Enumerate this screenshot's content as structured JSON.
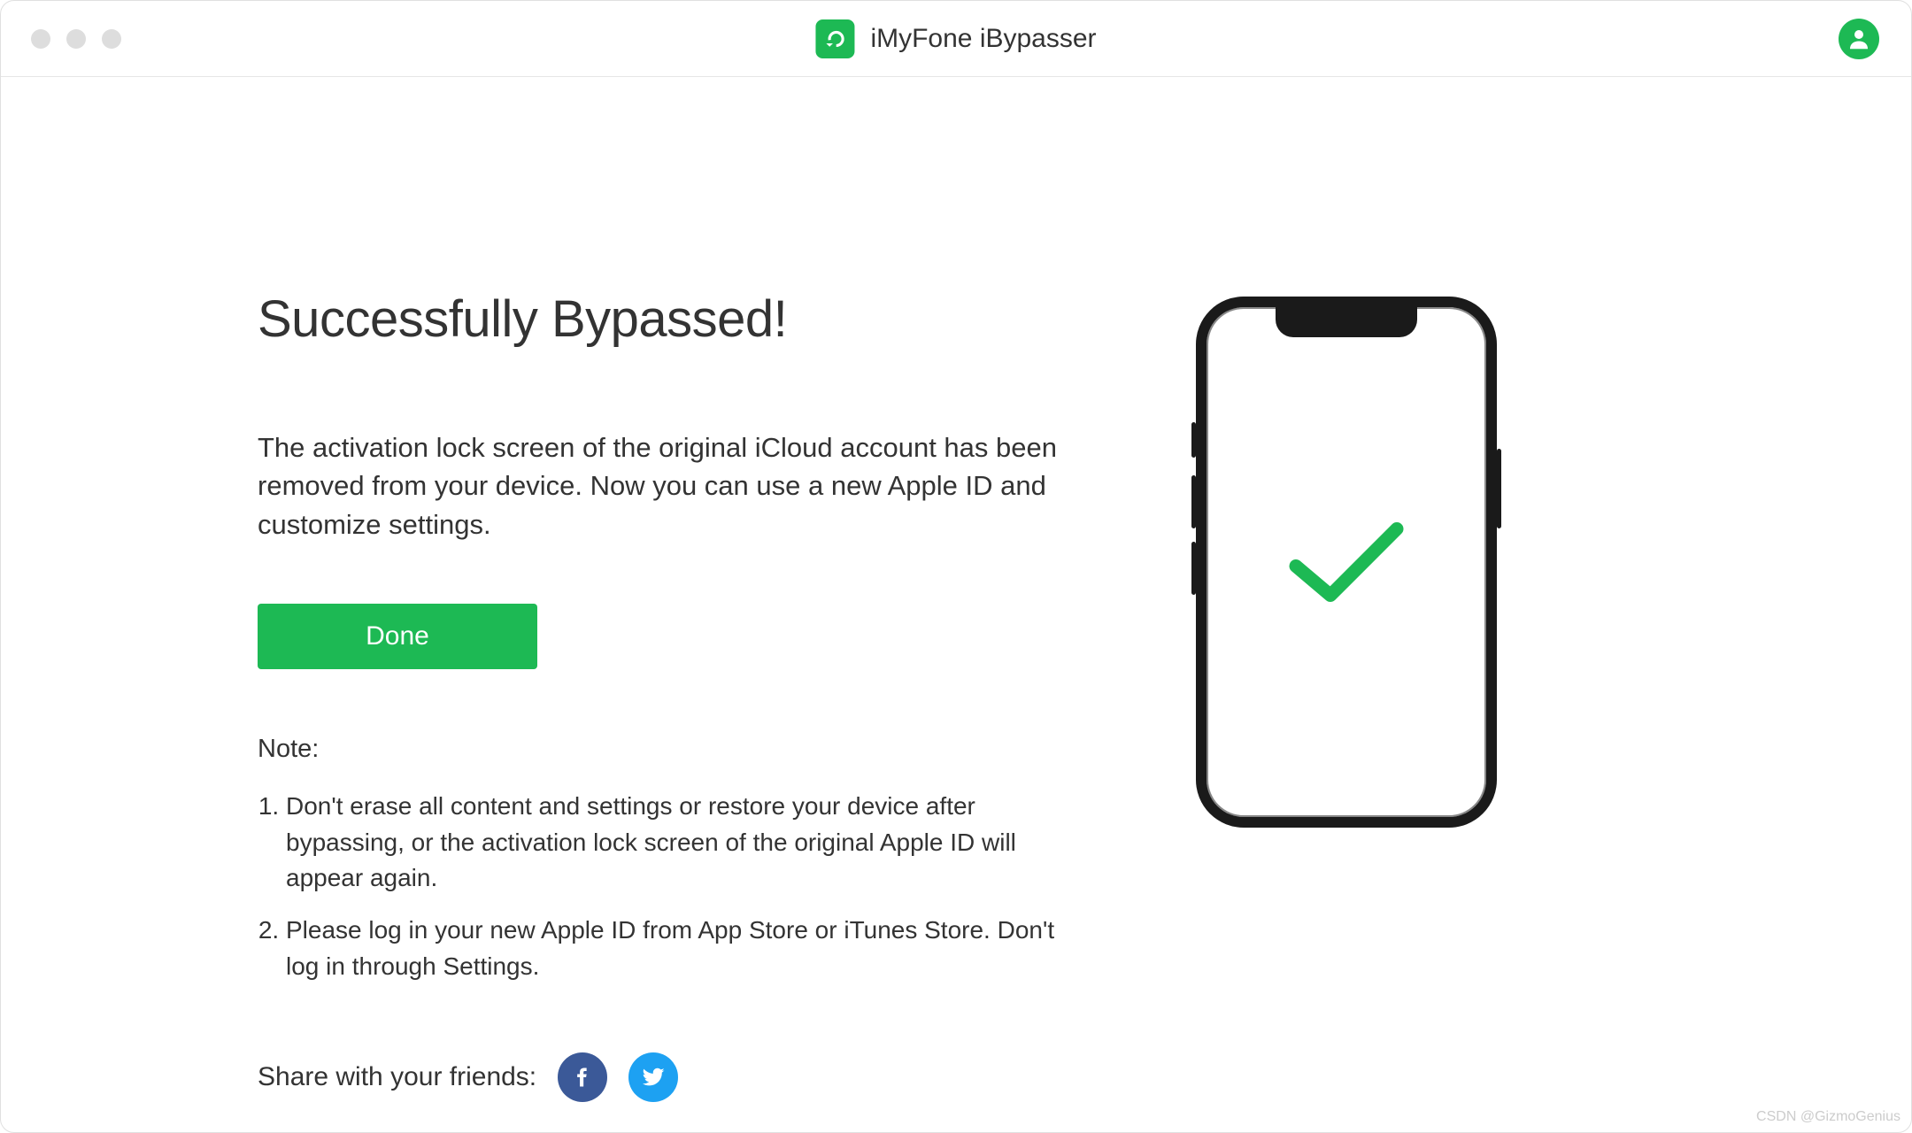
{
  "header": {
    "app_title": "iMyFone iBypasser"
  },
  "main": {
    "heading": "Successfully Bypassed!",
    "description": "The activation lock screen of the original iCloud account has been removed from your device. Now you can use a new Apple ID and customize settings.",
    "done_label": "Done",
    "note_label": "Note:",
    "notes": [
      "Don't erase all content and settings or restore your device after bypassing, or the activation lock screen of the original Apple ID will appear again.",
      "Please log in your new Apple ID from App Store or iTunes Store. Don't log in through Settings."
    ]
  },
  "share": {
    "label": "Share with your friends:"
  },
  "watermark": "CSDN @GizmoGenius",
  "colors": {
    "accent": "#1db954",
    "facebook": "#3b5998",
    "twitter": "#1da1f2"
  }
}
